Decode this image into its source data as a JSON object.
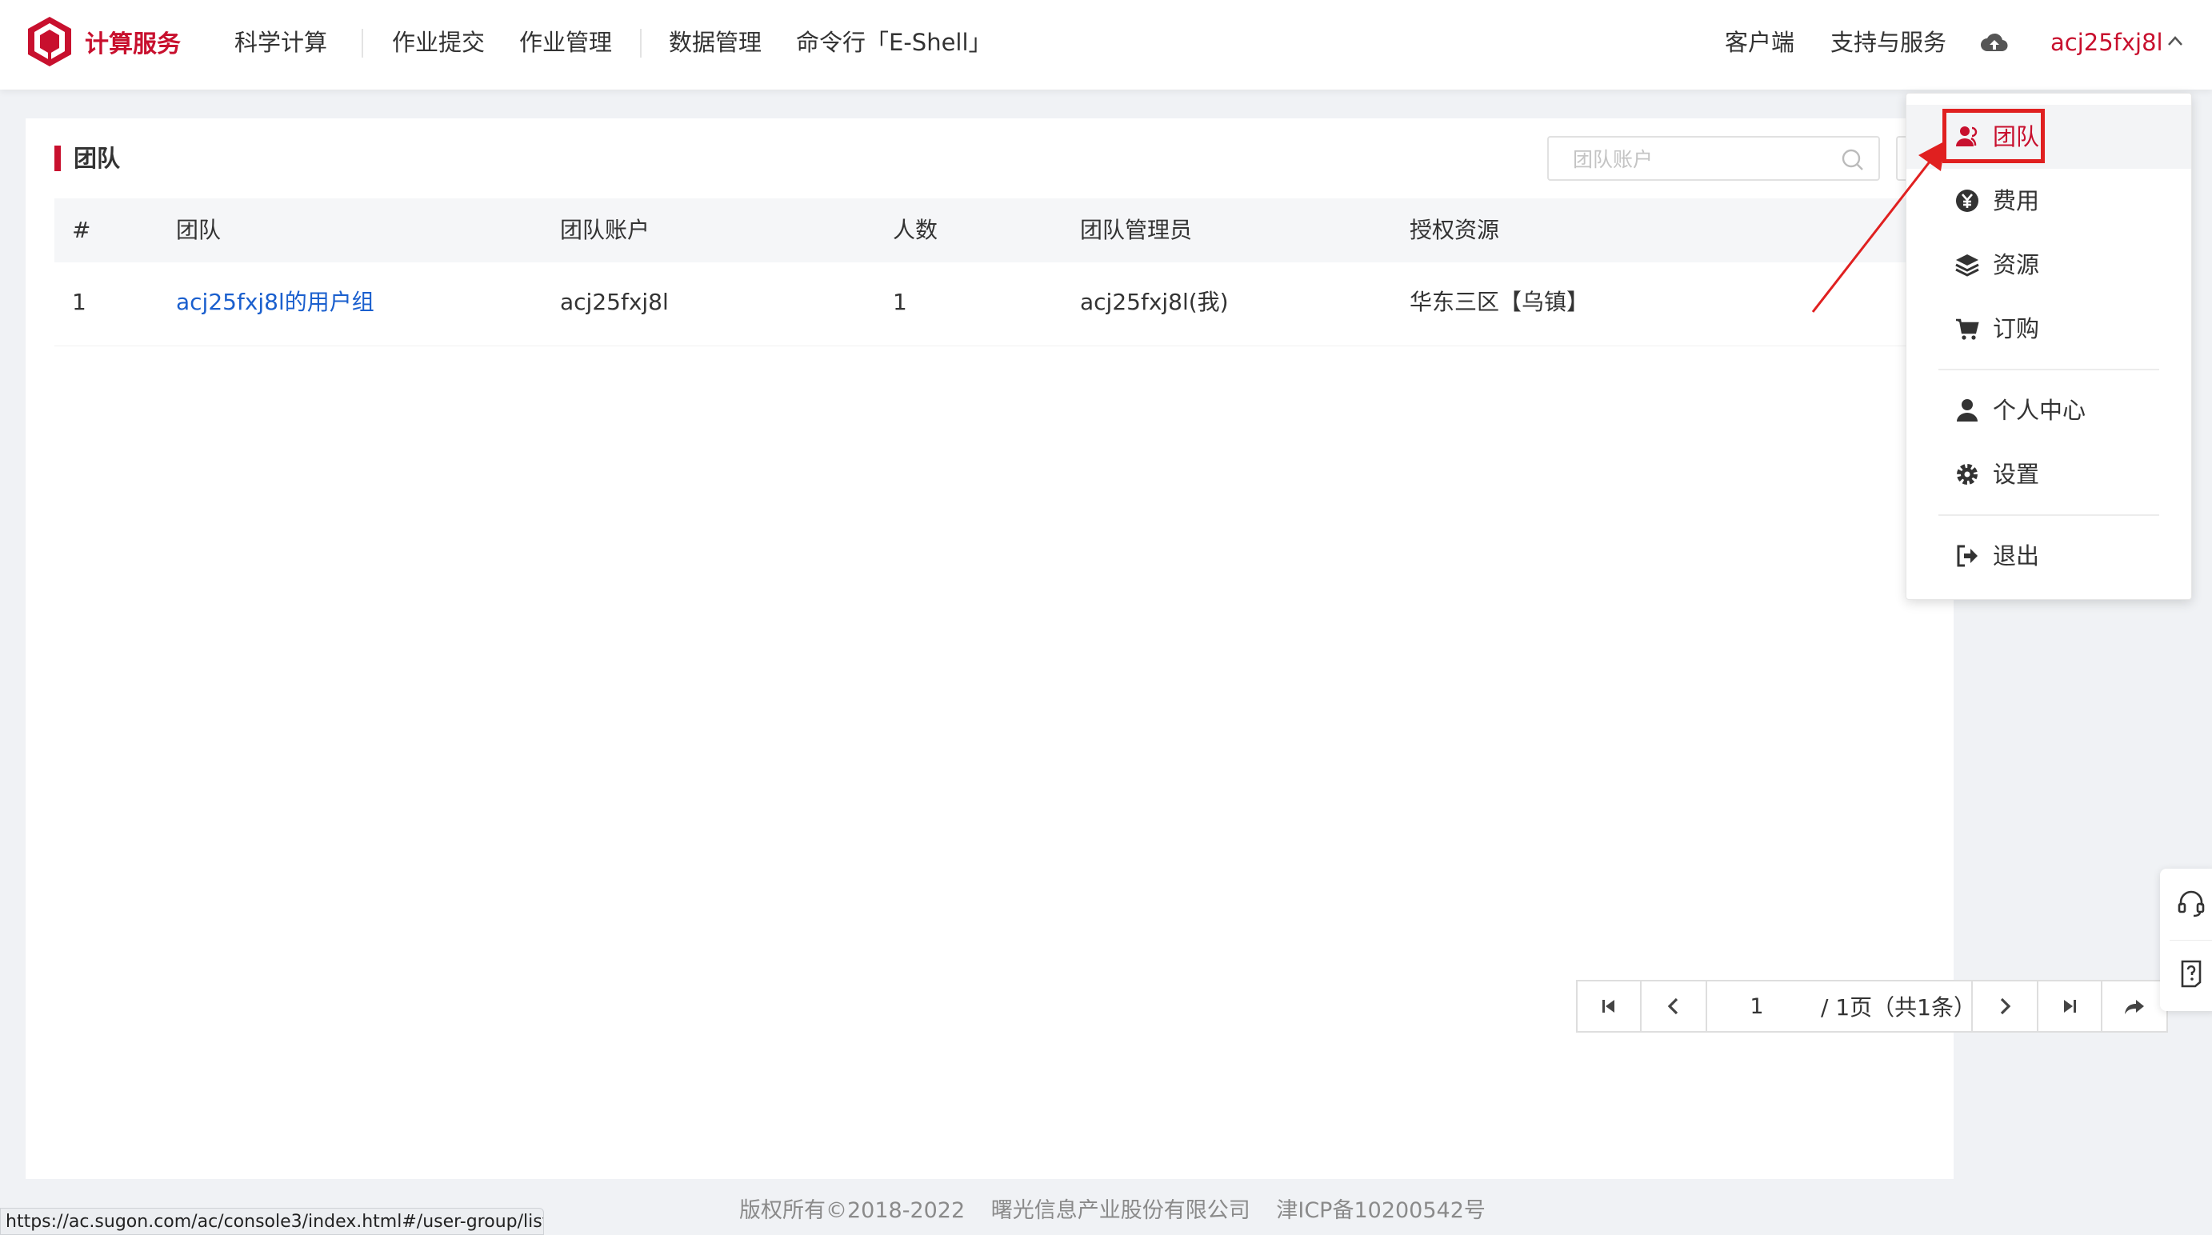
{
  "header": {
    "brand": "计算服务",
    "nav": [
      "科学计算",
      "作业提交",
      "作业管理",
      "数据管理",
      "命令行「E-Shell」"
    ],
    "right": [
      "客户端",
      "支持与服务"
    ],
    "username": "acj25fxj8l"
  },
  "panel": {
    "title": "团队",
    "search_placeholder": "团队账户"
  },
  "table": {
    "headers": [
      "#",
      "团队",
      "团队账户",
      "人数",
      "团队管理员",
      "授权资源"
    ],
    "rows": [
      [
        "1",
        "acj25fxj8l的用户组",
        "acj25fxj8l",
        "1",
        "acj25fxj8l(我)",
        "华东三区【乌镇】"
      ]
    ]
  },
  "pagination": {
    "current": "1",
    "info": "/ 1页（共1条）"
  },
  "dropdown": {
    "items": [
      {
        "label": "团队",
        "icon": "team-icon"
      },
      {
        "label": "费用",
        "icon": "yuan-icon"
      },
      {
        "label": "资源",
        "icon": "layers-icon"
      },
      {
        "label": "订购",
        "icon": "cart-icon"
      },
      {
        "label": "个人中心",
        "icon": "user-icon"
      },
      {
        "label": "设置",
        "icon": "gear-icon"
      },
      {
        "label": "退出",
        "icon": "logout-icon"
      }
    ]
  },
  "footer": {
    "copyright": "版权所有©2018-2022",
    "company": "曙光信息产业股份有限公司",
    "icp": "津ICP备10200542号"
  },
  "status_url": "https://ac.sugon.com/ac/console3/index.html#/user-group/list",
  "colors": {
    "brand": "#c8102e",
    "link": "#1a5fce",
    "annotation": "#e02020"
  }
}
